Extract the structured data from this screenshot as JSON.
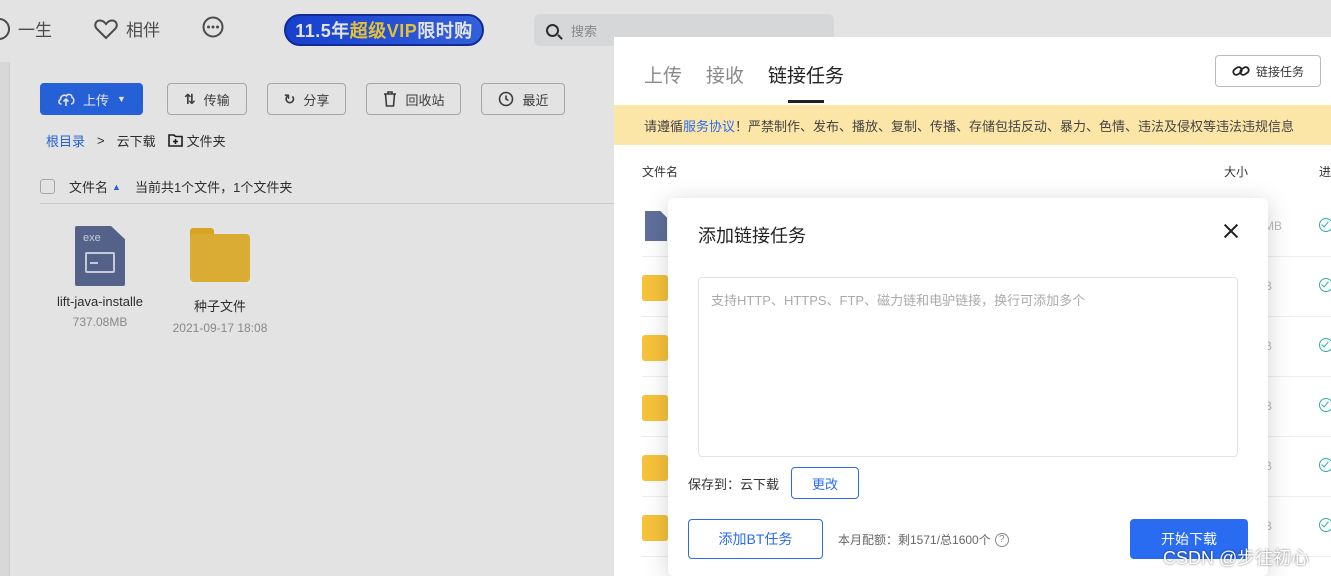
{
  "topbar": {
    "item1": "一生",
    "item2": "相伴",
    "vip_prefix": "11.5年",
    "vip_highlight": "超级VIP",
    "vip_suffix": "限时购",
    "search_placeholder": "搜索"
  },
  "toolbar": {
    "upload": "上传",
    "transfer": "传输",
    "share": "分享",
    "recycle": "回收站",
    "recent": "最近"
  },
  "breadcrumb": {
    "root": "根目录",
    "sep": ">",
    "current": "云下载",
    "folder": "文件夹"
  },
  "file_header": {
    "name": "文件名",
    "summary": "当前共1个文件，1个文件夹"
  },
  "files": [
    {
      "name": "lift-java-installe",
      "meta": "737.08MB",
      "icon": "exe-file-icon",
      "icon_label": "exe"
    },
    {
      "name": "种子文件",
      "meta": "2021-09-17 18:08",
      "icon": "folder-icon"
    }
  ],
  "panel": {
    "tabs": [
      "上传",
      "接收",
      "链接任务"
    ],
    "active_tab": "链接任务",
    "link_task_button": "链接任务",
    "notice_prefix": "请遵循",
    "notice_link": "服务协议",
    "notice_text": "！严禁制作、发布、播放、复制、传播、存储包括反动、暴力、色情、违法及侵权等违法违规信息",
    "list_header": {
      "name": "文件名",
      "size": "大小",
      "progress": "进"
    },
    "rows": [
      {
        "type": "exe",
        "size": "MB"
      },
      {
        "type": "folder",
        "size": "B"
      },
      {
        "type": "folder",
        "size": "B"
      },
      {
        "type": "folder",
        "size": "B"
      },
      {
        "type": "folder",
        "size": "B"
      },
      {
        "type": "folder",
        "size": "B"
      }
    ]
  },
  "modal": {
    "title": "添加链接任务",
    "textarea_placeholder": "支持HTTP、HTTPS、FTP、磁力链和电驴链接，换行可添加多个",
    "save_label": "保存到：",
    "save_location": "云下载",
    "change_button": "更改",
    "bt_button": "添加BT任务",
    "quota": "本月配额：剩1571/总1600个",
    "start_button": "开始下载"
  },
  "watermark": "CSDN @步往初心",
  "colors": {
    "accent": "#2a6cf1",
    "notice_bg": "#fbe5a7",
    "folder": "#f7c23a"
  }
}
